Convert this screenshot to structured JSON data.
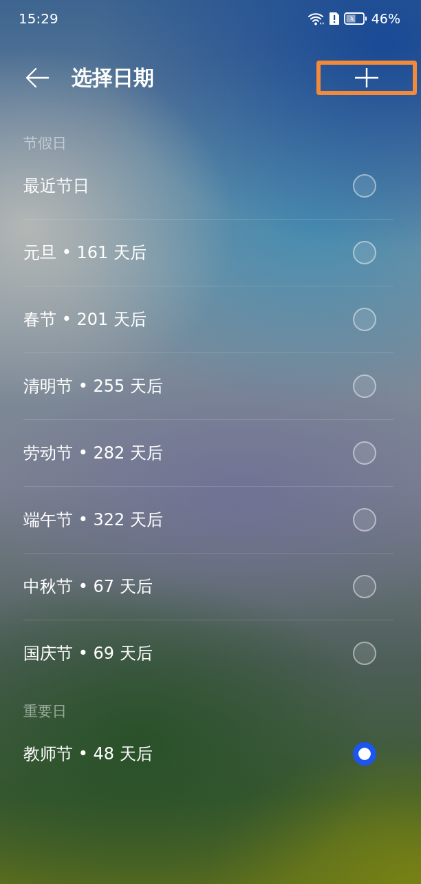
{
  "status_bar": {
    "time": "15:29",
    "battery": "46%"
  },
  "header": {
    "title": "选择日期",
    "add_button": {
      "highlighted": true
    }
  },
  "sections": [
    {
      "label": "节假日",
      "items": [
        {
          "label": "最近节日",
          "selected": false
        },
        {
          "label": "元旦 • 161 天后",
          "selected": false
        },
        {
          "label": "春节 • 201 天后",
          "selected": false
        },
        {
          "label": "清明节 • 255 天后",
          "selected": false
        },
        {
          "label": "劳动节 • 282 天后",
          "selected": false
        },
        {
          "label": "端午节 • 322 天后",
          "selected": false
        },
        {
          "label": "中秋节 • 67 天后",
          "selected": false
        },
        {
          "label": "国庆节 • 69 天后",
          "selected": false
        }
      ]
    },
    {
      "label": "重要日",
      "items": [
        {
          "label": "教师节 • 48 天后",
          "selected": true
        }
      ]
    }
  ]
}
